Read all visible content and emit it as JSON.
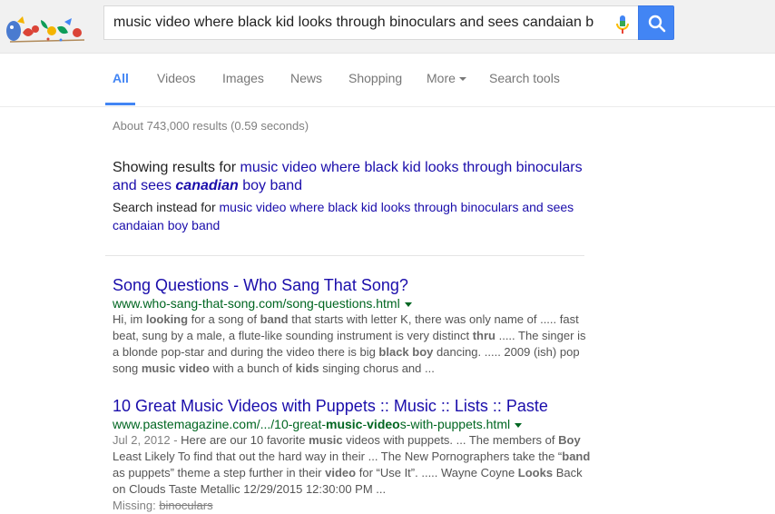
{
  "search": {
    "query": "music video where black kid looks through binoculars and sees candaian b",
    "button_label": "Search"
  },
  "colors": {
    "accent": "#4285f4",
    "link": "#1a0dab",
    "url": "#006621"
  },
  "tabs": [
    {
      "label": "All",
      "active": true
    },
    {
      "label": "Videos"
    },
    {
      "label": "Images"
    },
    {
      "label": "News"
    },
    {
      "label": "Shopping"
    },
    {
      "label": "More"
    },
    {
      "label": "Search tools"
    }
  ],
  "stats": "About 743,000 results (0.59 seconds)",
  "correction": {
    "showing_prefix": "Showing results for",
    "showing_link_a": "music video where black kid looks through binoculars and sees",
    "showing_link_bold": "canadian",
    "showing_link_b": "boy band",
    "instead_prefix": "Search instead for",
    "instead_link": "music video where black kid looks through binoculars and sees candaian boy band"
  },
  "results": [
    {
      "title": "Song Questions - Who Sang That Song?",
      "url": "www.who-sang-that-song.com/song-questions.html",
      "snippet": [
        {
          "t": "Hi, im "
        },
        {
          "t": "looking",
          "b": true
        },
        {
          "t": " for a song of "
        },
        {
          "t": "band",
          "b": true
        },
        {
          "t": " that starts with letter K, there was only name of ..... fast beat, sung by a male, a flute-like sounding instrument is very distinct "
        },
        {
          "t": "thru",
          "b": true
        },
        {
          "t": " ..... The singer is a blonde pop-star and during the video there is big "
        },
        {
          "t": "black boy",
          "b": true
        },
        {
          "t": " dancing. ..... 2009 (ish) pop song "
        },
        {
          "t": "music video",
          "b": true
        },
        {
          "t": " with a bunch of "
        },
        {
          "t": "kids",
          "b": true
        },
        {
          "t": " singing chorus and  ..."
        }
      ]
    },
    {
      "title": "10 Great Music Videos with Puppets :: Music :: Lists :: Paste",
      "url_parts": [
        {
          "t": "www.pastemagazine.com/.../10-great-"
        },
        {
          "t": "music",
          "b": true
        },
        {
          "t": "-"
        },
        {
          "t": "video",
          "b": true
        },
        {
          "t": "s-with-puppets.html"
        }
      ],
      "date": "Jul 2, 2012 - ",
      "snippet": [
        {
          "t": "Here are our 10 favorite "
        },
        {
          "t": "music",
          "b": true
        },
        {
          "t": " videos with puppets. ... The members of "
        },
        {
          "t": "Boy",
          "b": true
        },
        {
          "t": " Least Likely To find that out the hard way in their ... The New Pornographers take the “"
        },
        {
          "t": "band",
          "b": true
        },
        {
          "t": " as puppets” theme a step further in their "
        },
        {
          "t": "video",
          "b": true
        },
        {
          "t": " for “Use It”. ..... Wayne Coyne "
        },
        {
          "t": "Looks",
          "b": true
        },
        {
          "t": " Back on Clouds Taste Metallic 12/29/2015 12:30:00 PM  ..."
        }
      ],
      "missing_label": "Missing:",
      "missing_term": "binoculars"
    }
  ]
}
